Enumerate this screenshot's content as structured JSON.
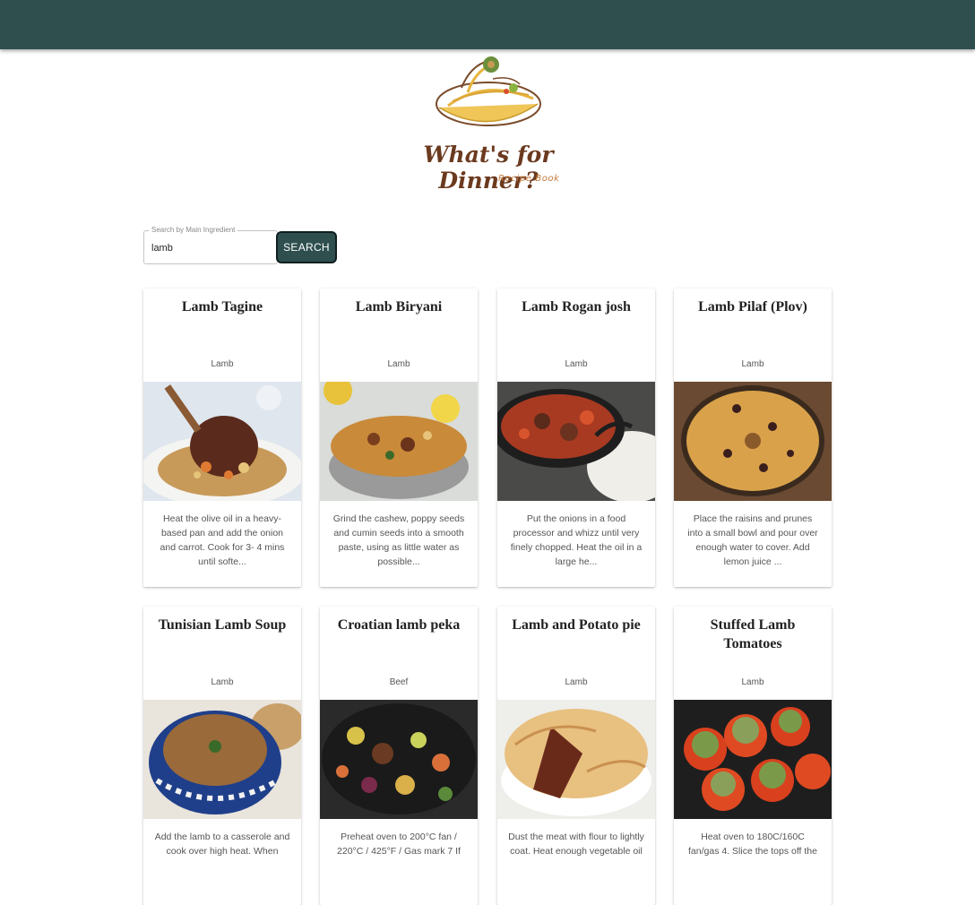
{
  "header": {
    "bar_color": "#2f4f4f"
  },
  "logo": {
    "title": "What's for Dinner?",
    "subtitle": "Recipe Book"
  },
  "search": {
    "label": "Search by Main Ingredient",
    "value": "lamb",
    "button_label": "SEARCH"
  },
  "recipes": [
    {
      "title": "Lamb Tagine",
      "category": "Lamb",
      "description": "Heat the olive oil in a heavy-based pan and add the onion and carrot. Cook for 3- 4 mins until softe...",
      "image_icon": "tagine-photo"
    },
    {
      "title": "Lamb Biryani",
      "category": "Lamb",
      "description": "Grind the cashew, poppy seeds and cumin seeds into a smooth paste, using as little water as possible...",
      "image_icon": "biryani-photo"
    },
    {
      "title": "Lamb Rogan josh",
      "category": "Lamb",
      "description": "Put the onions in a food processor and whizz until very finely chopped. Heat the oil in a large he...",
      "image_icon": "rogan-josh-photo"
    },
    {
      "title": "Lamb Pilaf (Plov)",
      "category": "Lamb",
      "description": "Place the raisins and prunes into a small bowl and pour over enough water to cover. Add lemon juice ...",
      "image_icon": "pilaf-photo"
    },
    {
      "title": "Tunisian Lamb Soup",
      "category": "Lamb",
      "description": "Add the lamb to a casserole and cook over high heat. When",
      "image_icon": "soup-photo"
    },
    {
      "title": "Croatian lamb peka",
      "category": "Beef",
      "description": "Preheat oven to 200°C fan / 220°C / 425°F / Gas mark 7 If",
      "image_icon": "peka-photo"
    },
    {
      "title": "Lamb and Potato pie",
      "category": "Lamb",
      "description": "Dust the meat with flour to lightly coat. Heat enough vegetable oil",
      "image_icon": "pie-photo"
    },
    {
      "title": "Stuffed Lamb Tomatoes",
      "category": "Lamb",
      "description": "Heat oven to 180C/160C fan/gas 4. Slice the tops off the",
      "image_icon": "stuffed-tomatoes-photo"
    }
  ]
}
